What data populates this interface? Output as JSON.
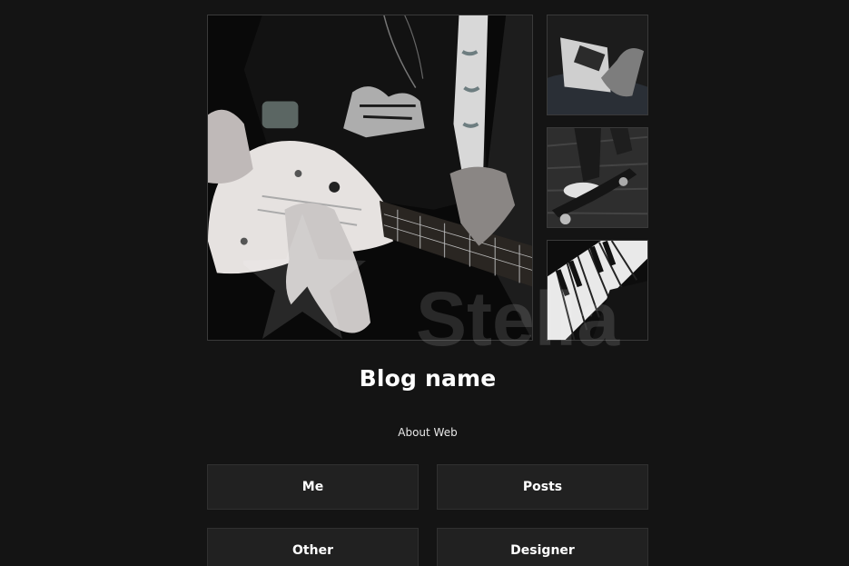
{
  "blog": {
    "name": "Blog name",
    "about": "About Web"
  },
  "nav": {
    "me": "Me",
    "posts": "Posts",
    "other": "Other",
    "designer": "Designer"
  },
  "watermark": {
    "text": "Stella"
  },
  "colors": {
    "background": "#141414",
    "button": "#212121",
    "text": "#ffffff"
  }
}
